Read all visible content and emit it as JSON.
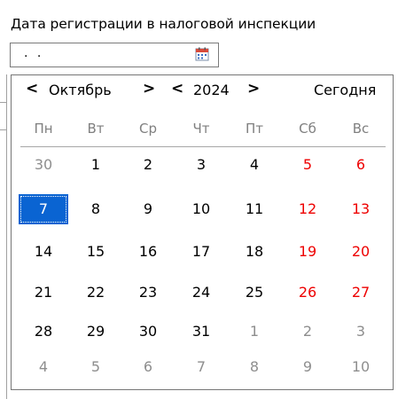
{
  "field": {
    "label": "Дата регистрации в налоговой инспекции",
    "value": ". .",
    "button_icon": "calendar-icon"
  },
  "calendar": {
    "prev_month_symbol": "<",
    "month": "Октябрь",
    "next_month_symbol": ">",
    "prev_year_symbol": "<",
    "year": "2024",
    "next_year_symbol": ">",
    "today_label": "Сегодня",
    "weekdays": [
      "Пн",
      "Вт",
      "Ср",
      "Чт",
      "Пт",
      "Сб",
      "Вс"
    ],
    "weeks": [
      [
        "30",
        "1",
        "2",
        "3",
        "4",
        "5",
        "6"
      ],
      [
        "7",
        "8",
        "9",
        "10",
        "11",
        "12",
        "13"
      ],
      [
        "14",
        "15",
        "16",
        "17",
        "18",
        "19",
        "20"
      ],
      [
        "21",
        "22",
        "23",
        "24",
        "25",
        "26",
        "27"
      ],
      [
        "28",
        "29",
        "30",
        "31",
        "1",
        "2",
        "3"
      ],
      [
        "4",
        "5",
        "6",
        "7",
        "8",
        "9",
        "10"
      ]
    ],
    "selected_day": "7",
    "colors": {
      "weekend": "#ee0000",
      "other_month": "#8e8e8e",
      "selected_background": "#0a64d2",
      "selected_text": "#ffffff"
    }
  }
}
